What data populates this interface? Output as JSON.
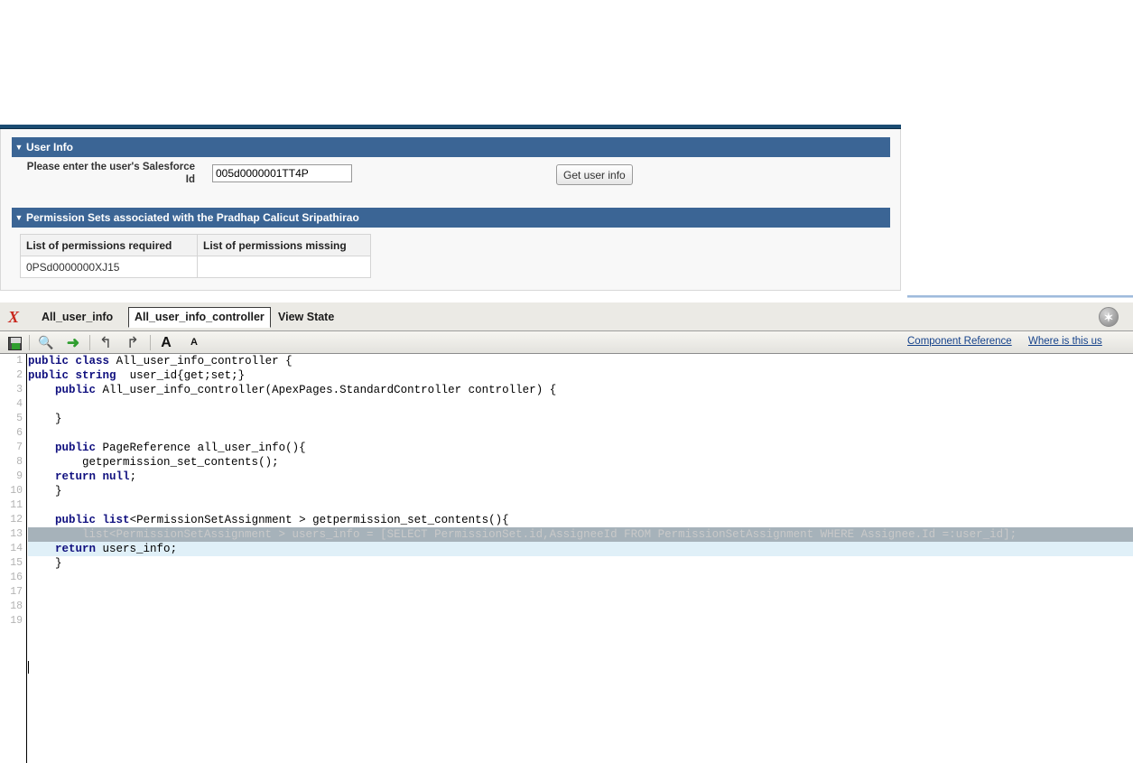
{
  "vf_page": {
    "sections": [
      {
        "id": "user-info",
        "twisty": "▼",
        "title": "User Info"
      },
      {
        "id": "perm-sets",
        "twisty": "▼",
        "title": "Permission Sets associated with the Pradhap Calicut Sripathirao"
      }
    ],
    "field": {
      "label": "Please enter the user's Salesforce Id",
      "value": "005d0000001TT4P",
      "placeholder": ""
    },
    "get_user_info_button": "Get user info",
    "table": {
      "headers": [
        "List of permissions required",
        "List of permissions missing"
      ],
      "rows": [
        [
          "0PSd0000000XJ15",
          ""
        ]
      ]
    }
  },
  "dev_console": {
    "logo": "X",
    "tabs": [
      {
        "label": "All_user_info",
        "active": false
      },
      {
        "label": "All_user_info_controller",
        "active": true
      },
      {
        "label": "View State",
        "active": false
      }
    ],
    "close_button": "✶",
    "toolbar": {
      "icons": [
        {
          "name": "save-icon",
          "glyph": ""
        },
        {
          "name": "search-icon",
          "glyph": "🔍"
        },
        {
          "name": "go-to-icon",
          "glyph": "➜"
        },
        {
          "name": "undo-icon",
          "glyph": "↰"
        },
        {
          "name": "redo-icon",
          "glyph": "↱"
        },
        {
          "name": "font-increase-icon",
          "glyph": "A"
        },
        {
          "name": "font-decrease-icon",
          "glyph": "A"
        }
      ],
      "links": [
        {
          "label": "Component Reference"
        },
        {
          "label": "Where is this us"
        }
      ]
    },
    "editor": {
      "line_numbers": [
        "1",
        "2",
        "3",
        "4",
        "5",
        "6",
        "7",
        "8",
        "9",
        "10",
        "11",
        "12",
        "13",
        "14",
        "15",
        "16",
        "17",
        "18",
        "19"
      ],
      "lines": [
        {
          "n": 1,
          "text": "public class All_user_info_controller {",
          "state": "normal"
        },
        {
          "n": 2,
          "text": "public string  user_id{get;set;}",
          "state": "normal"
        },
        {
          "n": 3,
          "text": "    public All_user_info_controller(ApexPages.StandardController controller) {",
          "state": "normal"
        },
        {
          "n": 4,
          "text": "",
          "state": "normal"
        },
        {
          "n": 5,
          "text": "    }",
          "state": "normal"
        },
        {
          "n": 6,
          "text": "",
          "state": "normal"
        },
        {
          "n": 7,
          "text": "    public PageReference all_user_info(){",
          "state": "normal"
        },
        {
          "n": 8,
          "text": "        getpermission_set_contents();",
          "state": "normal"
        },
        {
          "n": 9,
          "text": "    return null;",
          "state": "normal"
        },
        {
          "n": 10,
          "text": "    }",
          "state": "normal"
        },
        {
          "n": 11,
          "text": "",
          "state": "normal"
        },
        {
          "n": 12,
          "text": "    public list<PermissionSetAssignment > getpermission_set_contents(){",
          "state": "normal"
        },
        {
          "n": 13,
          "text": "        list<PermissionSetAssignment > users_info = [SELECT PermissionSet.id,AssigneeId FROM PermissionSetAssignment WHERE Assignee.Id =:user_id];",
          "state": "selected"
        },
        {
          "n": 14,
          "text": "    return users_info;",
          "state": "current"
        },
        {
          "n": 15,
          "text": "    }",
          "state": "normal"
        },
        {
          "n": 16,
          "text": "",
          "state": "normal"
        },
        {
          "n": 17,
          "text": "",
          "state": "normal"
        },
        {
          "n": 18,
          "text": "",
          "state": "normal"
        },
        {
          "n": 19,
          "text": "",
          "state": "normal"
        }
      ]
    }
  },
  "colors": {
    "header_blue": "#3b6595",
    "topbar_navy": "#1b4c72",
    "link_blue": "#15428b",
    "selection_grey": "#a6b2ba",
    "current_line_blue": "#e0f0f8"
  }
}
